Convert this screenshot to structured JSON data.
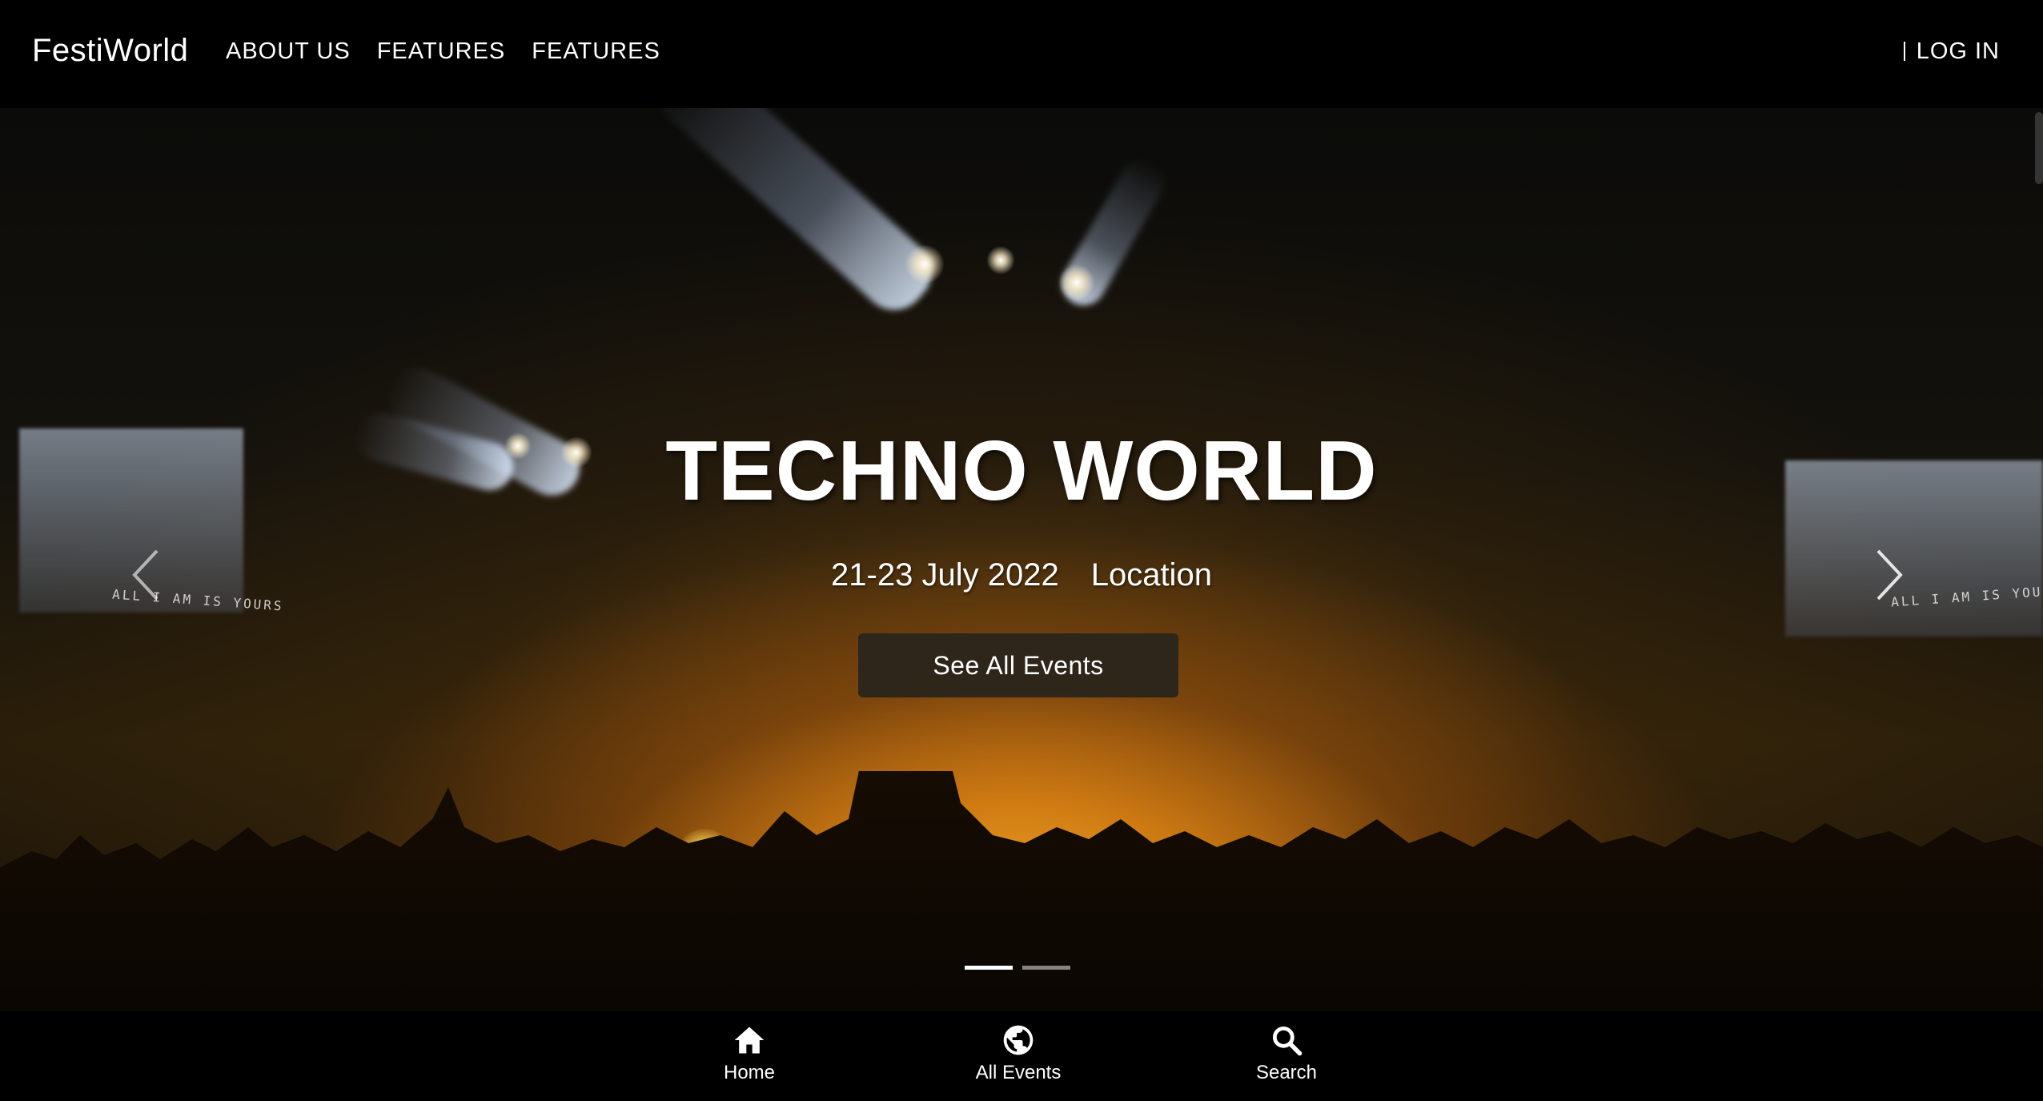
{
  "header": {
    "brand": "FestiWorld",
    "nav": [
      {
        "label": "ABOUT US"
      },
      {
        "label": "FEATURES"
      },
      {
        "label": "FEATURES"
      }
    ],
    "login_label": "LOG IN"
  },
  "hero": {
    "title": "TECHNO WORLD",
    "date": "21-23 July 2022",
    "location": "Location",
    "cta_label": "See All Events",
    "screen_text_left": "ALL I AM IS YOURS",
    "screen_text_right": "ALL I AM IS YOURS",
    "slide_count": 2,
    "active_slide": 1
  },
  "bottom_nav": {
    "items": [
      {
        "label": "Home",
        "icon": "home-icon"
      },
      {
        "label": "All Events",
        "icon": "globe-icon"
      },
      {
        "label": "Search",
        "icon": "search-icon"
      }
    ]
  },
  "colors": {
    "bar_background": "#000000",
    "cta_background": "#28241c",
    "text": "#ffffff",
    "stage_glow": "#ffb028"
  }
}
